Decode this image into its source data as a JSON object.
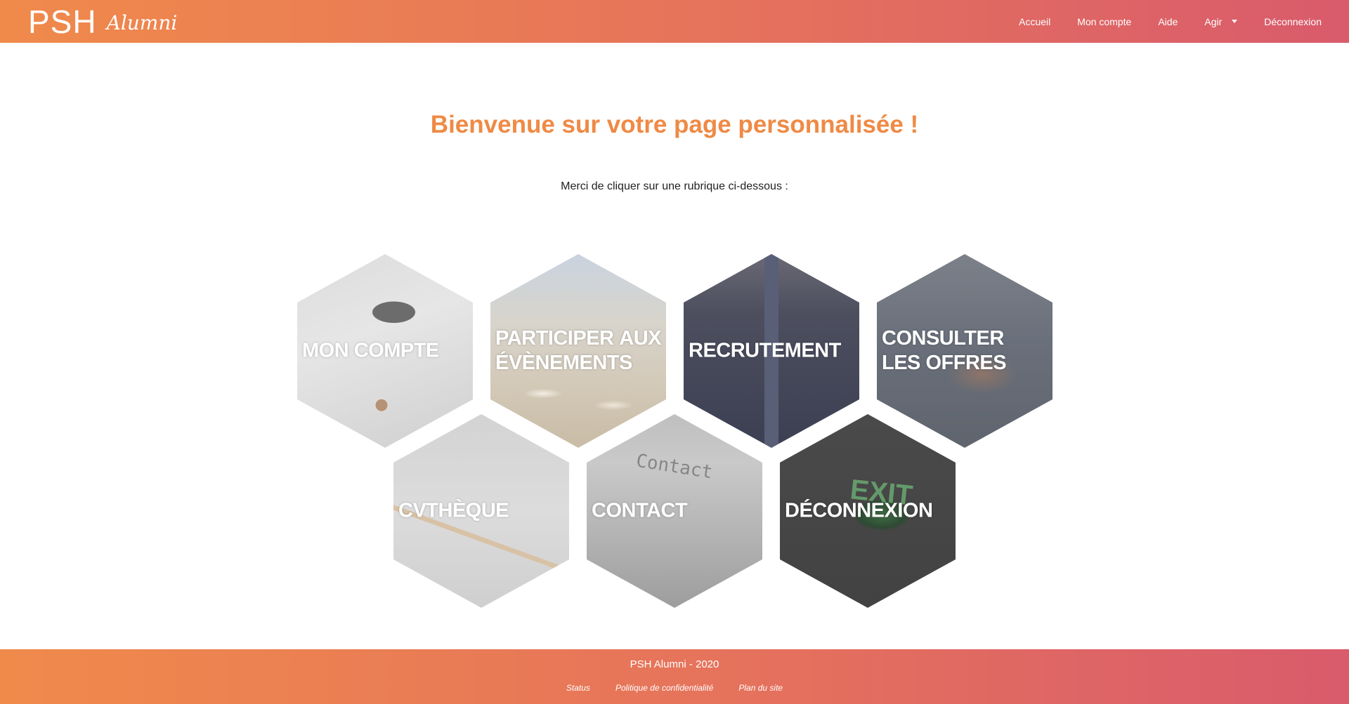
{
  "header": {
    "logo_main": "PSH",
    "logo_script": "Alumni",
    "nav": [
      {
        "label": "Accueil"
      },
      {
        "label": "Mon compte"
      },
      {
        "label": "Aide"
      },
      {
        "label": "Agir"
      },
      {
        "label": "Déconnexion"
      }
    ]
  },
  "main": {
    "title": "Bienvenue sur votre page personnalisée !",
    "subtitle": "Merci de cliquer sur une rubrique ci-dessous :",
    "tiles": [
      {
        "label": "MON COMPTE"
      },
      {
        "label": "PARTICIPER AUX ÉVÈNEMENTS"
      },
      {
        "label": "RECRUTEMENT"
      },
      {
        "label": "CONSULTER LES OFFRES"
      },
      {
        "label": "CVTHÈQUE"
      },
      {
        "label": "CONTACT",
        "photo_text": "Contact"
      },
      {
        "label": "DÉCONNEXION",
        "photo_text": "EXIT"
      }
    ]
  },
  "footer": {
    "copyright": "PSH Alumni - 2020",
    "links": [
      {
        "label": "Status"
      },
      {
        "label": "Politique de confidentialité"
      },
      {
        "label": "Plan du site"
      }
    ]
  },
  "colors": {
    "brand_orange": "#ef8a45",
    "gradient_start": "#f08a4b",
    "gradient_end": "#d95b6c"
  }
}
